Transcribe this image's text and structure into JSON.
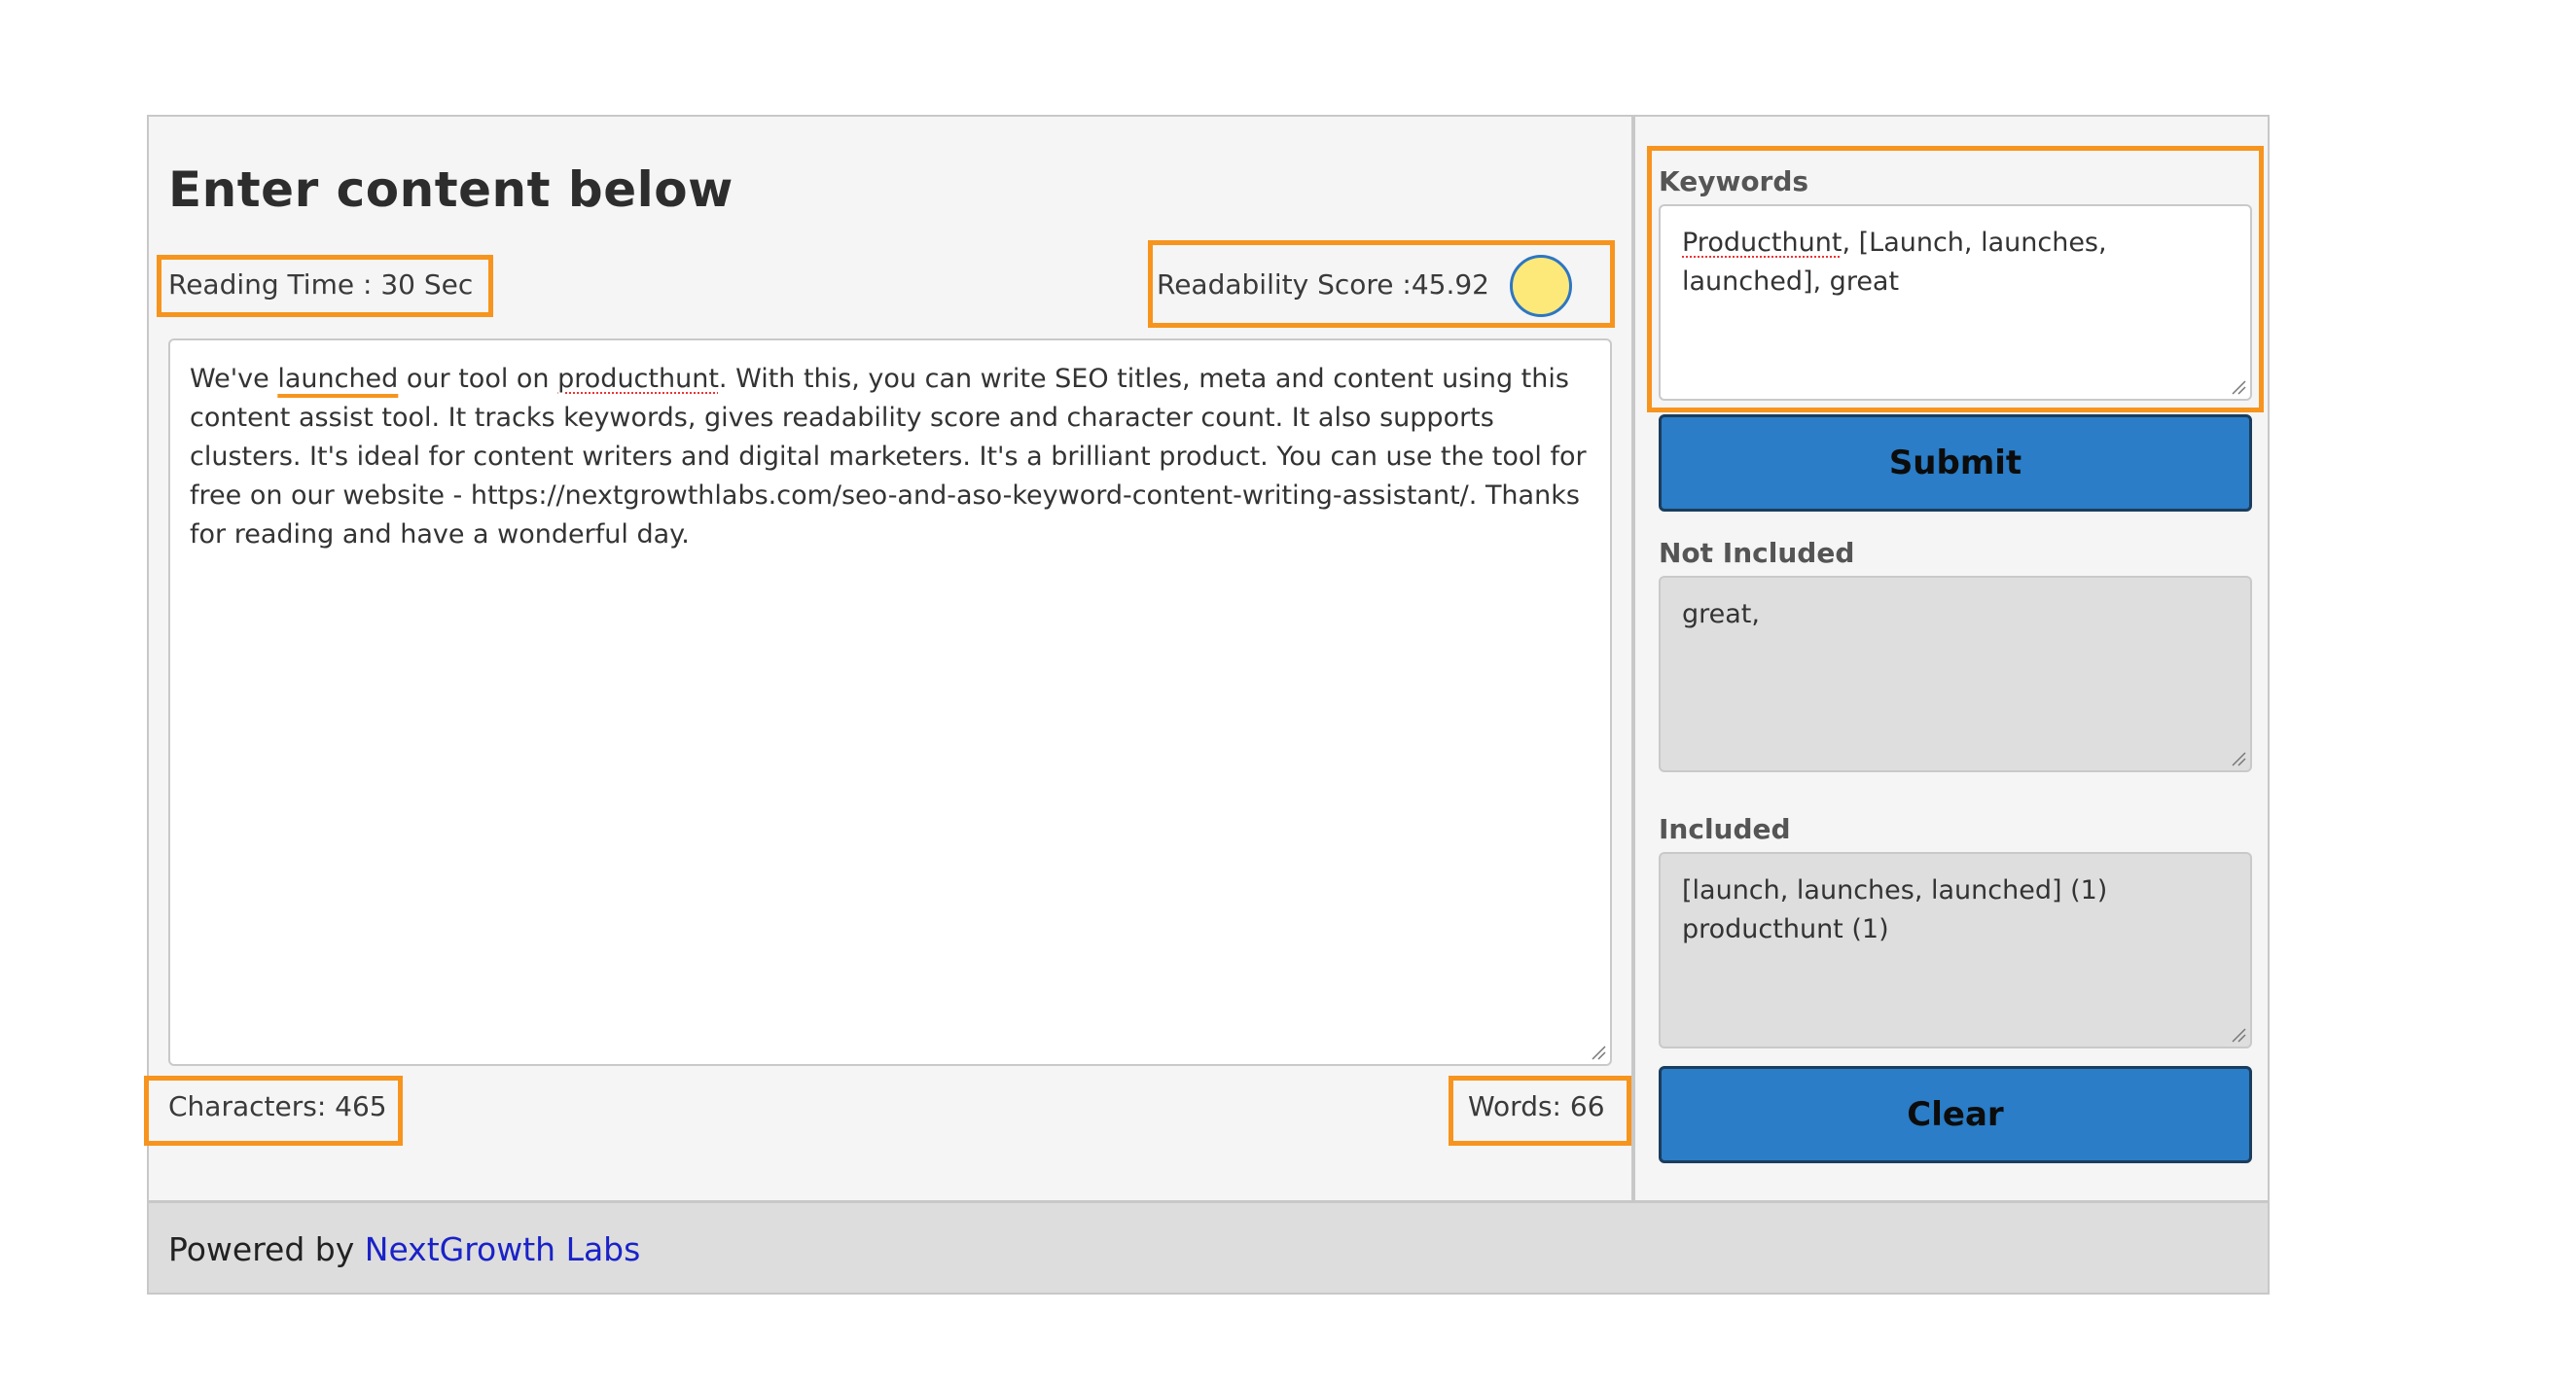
{
  "editor": {
    "title": "Enter content below",
    "reading_time": "Reading Time : 30 Sec",
    "readability": "Readability Score :45.92",
    "readability_color": "#fde97a",
    "content": {
      "p1": "We've ",
      "kw1": "launched",
      "p2": " our tool on ",
      "kw2": "producthunt",
      "p3": ". With this, you can write SEO titles, meta and content using this content assist tool. It tracks keywords, gives readability score and character count. It also supports clusters. It's ideal for content writers and digital marketers. It's a brilliant product. You can use the tool for free on our website - https://nextgrowthlabs.com/seo-and-aso-keyword-content-writing-assistant/. Thanks for reading and have a wonderful day."
    },
    "characters": "Characters: 465",
    "words": "Words: 66"
  },
  "sidebar": {
    "keywords_label": "Keywords",
    "keywords_value": {
      "kw1": "Producthunt",
      "rest": ", [Launch, launches, launched], great"
    },
    "submit_label": "Submit",
    "not_included_label": "Not Included",
    "not_included_value": "great,",
    "included_label": "Included",
    "included_lines": [
      "[launch, launches, launched] (1)",
      "producthunt (1)"
    ],
    "clear_label": "Clear"
  },
  "footer": {
    "prefix": "Powered by ",
    "link": "NextGrowth Labs"
  },
  "colors": {
    "highlight": "#f7941d",
    "button": "#2a7dc6",
    "link": "#1a22c8"
  }
}
